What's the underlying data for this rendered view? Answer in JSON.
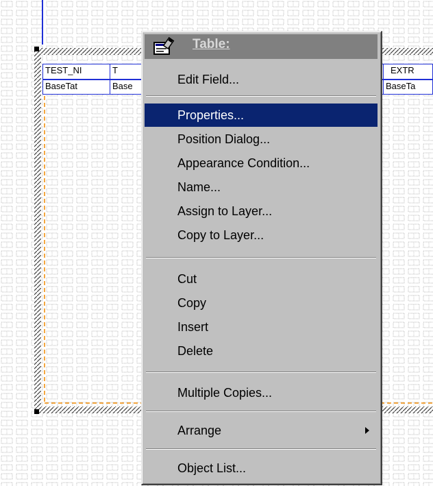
{
  "table": {
    "header_cells": [
      "TEST_NI",
      "T",
      "EXTR"
    ],
    "row_cells": [
      "BaseTat",
      "Base",
      "BaseTa"
    ]
  },
  "menu": {
    "title": "Table:",
    "title_icon": "properties-icon",
    "items": [
      {
        "label": "Edit Field..."
      },
      {
        "label": "Properties..."
      },
      {
        "label": "Position Dialog..."
      },
      {
        "label": "Appearance Condition..."
      },
      {
        "label": "Name..."
      },
      {
        "label": "Assign to Layer..."
      },
      {
        "label": "Copy to Layer..."
      },
      {
        "label": "Cut"
      },
      {
        "label": "Copy"
      },
      {
        "label": "Insert"
      },
      {
        "label": "Delete"
      },
      {
        "label": "Multiple Copies..."
      },
      {
        "label": "Arrange"
      },
      {
        "label": "Object List..."
      }
    ],
    "selected_item": "Properties...",
    "highlight_color": "#0a2470"
  }
}
